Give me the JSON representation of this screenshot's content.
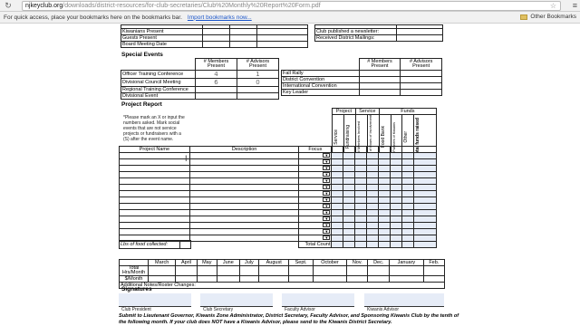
{
  "browser": {
    "url_host": "njkeyclub.org",
    "url_path": "/downloads/district-resources/for-club-secretaries/Club%20Monthly%20Report%20Form.pdf",
    "bookmarks_hint": "For quick access, place your bookmarks here on the bookmarks bar.",
    "import_link": "Import bookmarks now...",
    "other_bookmarks": "Other Bookmarks"
  },
  "top_rows_left": [
    "Kiwanians Present",
    "Guests Present",
    "Board Meeting Date"
  ],
  "top_rows_right": [
    "Club published a newsletter:",
    "Received District Mailings:"
  ],
  "special_events": {
    "title": "Special Events",
    "col_members": "# Members Present",
    "col_advisors": "# Advisors Present",
    "left": [
      {
        "label": "Officer Training Conference",
        "members": "4",
        "advisors": "1"
      },
      {
        "label": "Divisional Council Meeting",
        "members": "6",
        "advisors": "0"
      },
      {
        "label": "Regional Training Conference",
        "members": "",
        "advisors": ""
      },
      {
        "label": "Divisional Event",
        "members": "",
        "advisors": ""
      }
    ],
    "right": [
      "Fall Rally",
      "District Convention",
      "International Convention",
      "Key Leader"
    ]
  },
  "project_report": {
    "title": "Project Report",
    "note": "*Please mark an X or input the numbers asked. Mark social events that are not service projects or fundraisers with a (S) after the event name.",
    "group_headers": [
      "Project",
      "Service",
      "Funds"
    ],
    "vertical_headers": [
      "Service",
      "Fundraising",
      "# Members Involved",
      "Sum of Hours of Involvement",
      "Food Bank",
      "Partners of Kiwanis",
      "Other",
      "Total funds raised"
    ],
    "col_project_name": "Project Name",
    "col_description": "Description",
    "col_focus": "Focus",
    "dropdown_glyph": "▼",
    "total_count": "Total Count",
    "lbs_food": "Lbs of food collected:"
  },
  "monthly": {
    "months": [
      "March",
      "April",
      "May",
      "June",
      "July",
      "August",
      "Sept.",
      "October",
      "Nov.",
      "Dec.",
      "January",
      "Feb."
    ],
    "row_total": "Total",
    "row_hrs": "Hrs/Month",
    "row_dollars": "$/Month",
    "additional_notes": "Additional Notes/Roster Changes:"
  },
  "signatures": {
    "title": "Signatures",
    "labels": [
      "Club President",
      "Club Secretary",
      "Faculty Advisor",
      "Kiwanis Advisor"
    ],
    "footer": "Submit to Lieutenant Governor, Kiwanis Zone Administrator, District Secretary, Faculty Advisor, and Sponsoring Kiwanis Club by the tenth of the following month. If your club does NOT have a Kiwanis Advisor, please send to the Kiwanis District Secretary."
  }
}
